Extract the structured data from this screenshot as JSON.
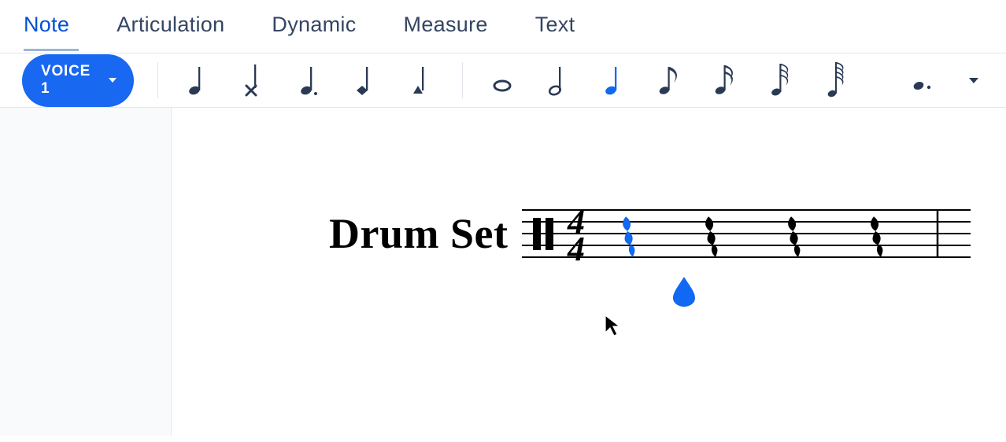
{
  "menu": {
    "items": [
      {
        "id": "note",
        "label": "Note",
        "active": true
      },
      {
        "id": "articulation",
        "label": "Articulation",
        "active": false
      },
      {
        "id": "dynamic",
        "label": "Dynamic",
        "active": false
      },
      {
        "id": "measure",
        "label": "Measure",
        "active": false
      },
      {
        "id": "text",
        "label": "Text",
        "active": false
      }
    ]
  },
  "toolbar": {
    "voice_label": "VOICE 1",
    "selected_note": "quarter-note",
    "items": [
      "quarter-note",
      "x-notehead",
      "dotted-dark-note",
      "diamond-note",
      "triangle-note",
      "sep",
      "whole-note",
      "half-note",
      "quarter-note-2",
      "eighth-note",
      "sixteenth-note",
      "thirtysecond-note",
      "sixtyfourth-note",
      "sep2",
      "dotted-pair"
    ]
  },
  "score": {
    "instrument_name": "Drum Set",
    "clef": "percussion",
    "time_signature": {
      "top": "4",
      "bottom": "4"
    },
    "rests": [
      "quarter",
      "quarter",
      "quarter",
      "quarter"
    ],
    "selected_rest_index": 0
  },
  "colors": {
    "accent": "#1868f2",
    "text_dark": "#2a3a55"
  }
}
